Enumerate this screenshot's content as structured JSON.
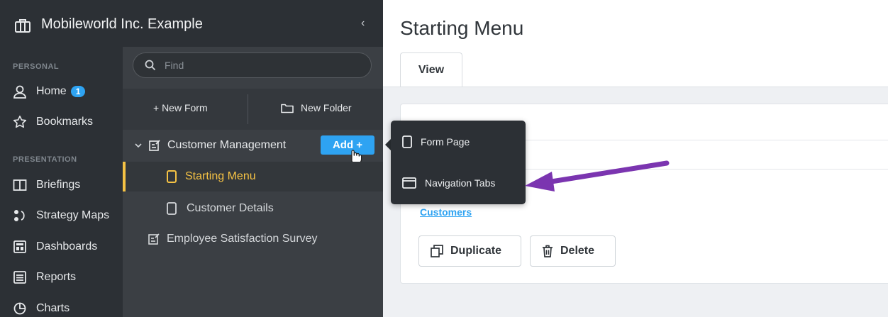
{
  "header": {
    "org_name": "Mobileworld Inc. Example",
    "collapse_glyph": "‹"
  },
  "sidebar": {
    "personal_label": "PERSONAL",
    "presentation_label": "PRESENTATION",
    "home": {
      "label": "Home",
      "badge": "1",
      "icon": "home-person-icon"
    },
    "bookmarks": {
      "label": "Bookmarks",
      "icon": "star-icon"
    },
    "briefings": {
      "label": "Briefings",
      "icon": "book-icon"
    },
    "strategy_maps": {
      "label": "Strategy Maps",
      "icon": "strategy-map-icon"
    },
    "dashboards": {
      "label": "Dashboards",
      "icon": "dashboard-icon"
    },
    "reports": {
      "label": "Reports",
      "icon": "report-icon"
    },
    "charts": {
      "label": "Charts",
      "icon": "pie-chart-icon"
    }
  },
  "tree": {
    "search_placeholder": "Find",
    "new_form": "+ New Form",
    "new_folder": "New Folder",
    "customer_management": "Customer Management",
    "add_button": "Add +",
    "starting_menu": "Starting Menu",
    "customer_details": "Customer Details",
    "employee_survey": "Employee Satisfaction Survey"
  },
  "popup": {
    "form_page": "Form Page",
    "navigation_tabs": "Navigation Tabs"
  },
  "main": {
    "title": "Starting Menu",
    "tab_view": "View",
    "customers_link": "Customers",
    "duplicate": "Duplicate",
    "delete": "Delete"
  },
  "colors": {
    "accent": "#2ea3f2",
    "active_bar": "#f5c244",
    "arrow": "#7b35b0"
  }
}
